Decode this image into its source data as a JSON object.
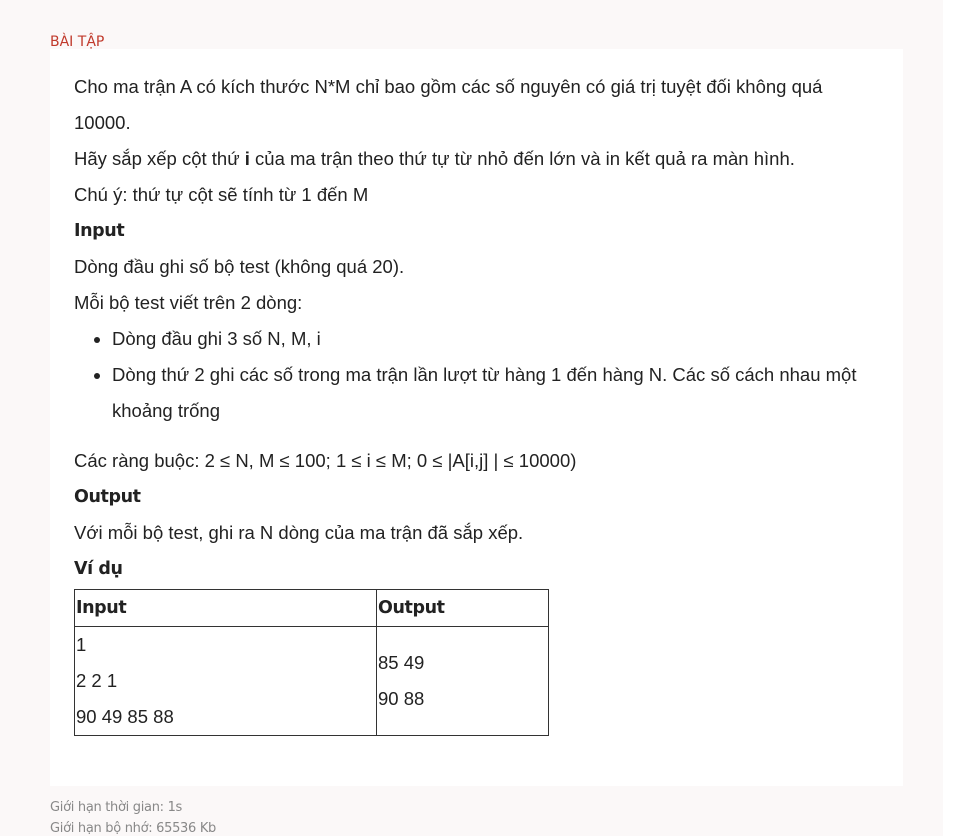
{
  "section_label": "BÀI TẬP",
  "problem": {
    "intro_line1": "Cho ma trận A có kích thước N*M chỉ bao gồm các số nguyên có giá trị tuyệt đối không quá",
    "intro_line2": "10000.",
    "task_prefix": "Hãy sắp xếp cột thứ ",
    "task_var": "i",
    "task_suffix": " của ma trận theo thứ tự từ nhỏ đến lớn và in kết quả ra màn hình.",
    "note": "Chú ý: thứ tự cột sẽ tính từ 1 đến M",
    "input_heading": "Input",
    "input_line1": "Dòng đầu ghi số bộ test (không quá 20).",
    "input_line2": "Mỗi bộ test viết trên 2 dòng:",
    "bullets": [
      "Dòng đầu ghi 3 số N, M, i",
      "Dòng thứ 2 ghi các số trong ma trận lần lượt từ hàng 1 đến hàng N. Các số cách nhau một khoảng trống"
    ],
    "constraints": "Các ràng buộc: 2 ≤  N, M  ≤ 100; 1 ≤ i ≤  M;  0 ≤ |A[i,j] | ≤ 10000)",
    "output_heading": "Output",
    "output_line": "Với mỗi bộ test, ghi ra N dòng của ma trận đã sắp xếp.",
    "example_heading": "Ví dụ",
    "example_table": {
      "headers": [
        "Input",
        "Output"
      ],
      "input_lines": [
        "1",
        "2 2 1",
        "90 49 85 88"
      ],
      "output_lines": [
        "85 49",
        "90 88"
      ]
    }
  },
  "footer": {
    "time_limit": "Giới hạn thời gian: 1s",
    "memory_limit": "Giới hạn bộ nhớ: 65536 Kb"
  }
}
